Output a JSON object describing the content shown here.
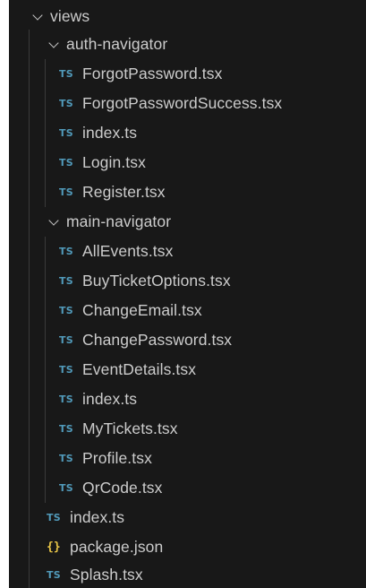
{
  "tree": {
    "root_folder": {
      "label": "views",
      "icon": "chevron-down-icon"
    },
    "auth_folder": {
      "label": "auth-navigator",
      "icon": "chevron-down-icon",
      "files": [
        {
          "icon_text": "TS",
          "label": "ForgotPassword.tsx"
        },
        {
          "icon_text": "TS",
          "label": "ForgotPasswordSuccess.tsx"
        },
        {
          "icon_text": "TS",
          "label": "index.ts"
        },
        {
          "icon_text": "TS",
          "label": "Login.tsx"
        },
        {
          "icon_text": "TS",
          "label": "Register.tsx"
        }
      ]
    },
    "main_folder": {
      "label": "main-navigator",
      "icon": "chevron-down-icon",
      "files": [
        {
          "icon_text": "TS",
          "label": "AllEvents.tsx"
        },
        {
          "icon_text": "TS",
          "label": "BuyTicketOptions.tsx"
        },
        {
          "icon_text": "TS",
          "label": "ChangeEmail.tsx"
        },
        {
          "icon_text": "TS",
          "label": "ChangePassword.tsx"
        },
        {
          "icon_text": "TS",
          "label": "EventDetails.tsx"
        },
        {
          "icon_text": "TS",
          "label": "index.ts"
        },
        {
          "icon_text": "TS",
          "label": "MyTickets.tsx"
        },
        {
          "icon_text": "TS",
          "label": "Profile.tsx"
        },
        {
          "icon_text": "TS",
          "label": "QrCode.tsx"
        }
      ]
    },
    "root_files": [
      {
        "icon_text": "TS",
        "label": "index.ts"
      },
      {
        "icon_text": "{}",
        "label": "package.json"
      },
      {
        "icon_text": "TS",
        "label": "Splash.tsx"
      }
    ]
  },
  "colors": {
    "background": "#181818",
    "text": "#cccccc",
    "ts_icon": "#519aba",
    "json_icon": "#e8c547",
    "indent_guide": "#3a3a3a"
  }
}
